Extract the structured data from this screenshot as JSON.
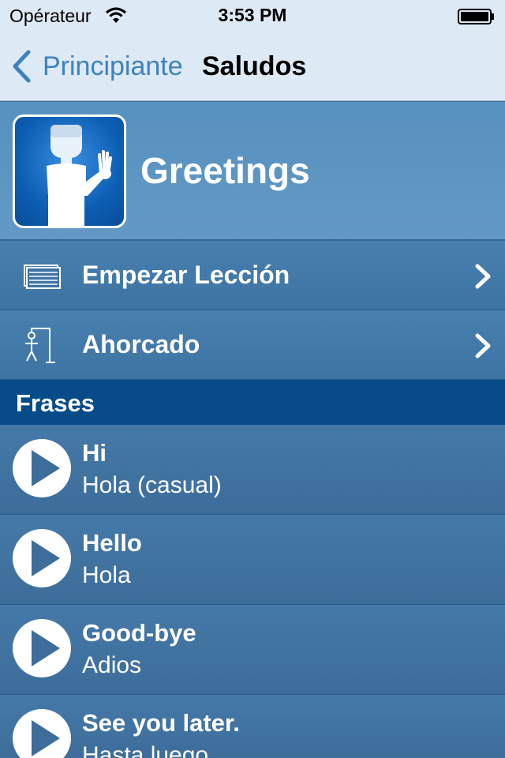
{
  "status_bar": {
    "carrier": "Opérateur",
    "time": "3:53 PM"
  },
  "nav": {
    "back_label": "Principiante",
    "title": "Saludos"
  },
  "header": {
    "title": "Greetings",
    "image_icon": "waving-person-icon"
  },
  "menu": [
    {
      "label": "Empezar Lección",
      "icon": "flashcards-icon"
    },
    {
      "label": "Ahorcado",
      "icon": "hangman-icon"
    }
  ],
  "section": {
    "title": "Frases"
  },
  "phrases": [
    {
      "english": "Hi",
      "spanish": "Hola (casual)"
    },
    {
      "english": "Hello",
      "spanish": "Hola"
    },
    {
      "english": "Good-bye",
      "spanish": "Adios"
    },
    {
      "english": "See you later.",
      "spanish": "Hasta luego"
    }
  ],
  "colors": {
    "nav_background": "#dde9f4",
    "accent": "#3e82bd",
    "section_header": "#074b89",
    "row_background": "#4579a8"
  }
}
